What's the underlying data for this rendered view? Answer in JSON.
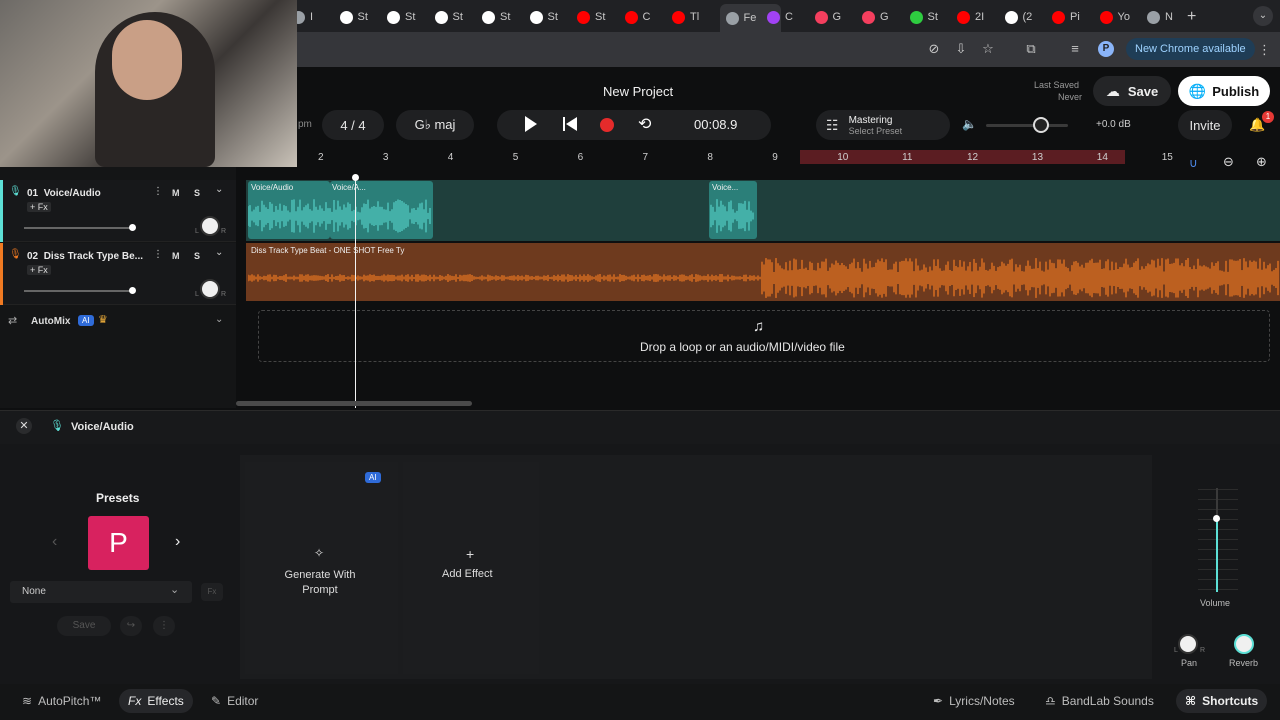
{
  "browser": {
    "tabs": [
      {
        "label": "I",
        "color": "#9aa0a6"
      },
      {
        "label": "St",
        "color": "#ffffff"
      },
      {
        "label": "St",
        "color": "#ffffff"
      },
      {
        "label": "St",
        "color": "#ffffff"
      },
      {
        "label": "St",
        "color": "#ffffff"
      },
      {
        "label": "St",
        "color": "#ffffff"
      },
      {
        "label": "St",
        "color": "#ff0000"
      },
      {
        "label": "C",
        "color": "#ff0000"
      },
      {
        "label": "Tl",
        "color": "#ff0000"
      },
      {
        "label": "Fe",
        "color": "#9aa0a6"
      },
      {
        "label": "C",
        "color": "#a142f4"
      },
      {
        "label": "G",
        "color": "#f43f5e"
      },
      {
        "label": "G",
        "color": "#f43f5e"
      },
      {
        "label": "St",
        "color": "#2ecc40"
      },
      {
        "label": "2I",
        "color": "#ff0000"
      },
      {
        "label": "(2",
        "color": "#ffffff"
      },
      {
        "label": "Pi",
        "color": "#ff0000"
      },
      {
        "label": "Yo",
        "color": "#ff0000"
      },
      {
        "label": "N",
        "color": "#9aa0a6"
      }
    ],
    "new_chrome": "New Chrome available",
    "profile_initial": "P"
  },
  "app": {
    "project_title": "New Project",
    "last_saved_label": "Last Saved",
    "last_saved_value": "Never",
    "save": "Save",
    "publish": "Publish",
    "tempo_suffix": "pm",
    "time_sig": "4 / 4",
    "key": "G♭ maj",
    "time": "00:08.9",
    "mastering": "Mastering",
    "select_preset": "Select Preset",
    "gain": "+0.0 dB",
    "invite": "Invite",
    "notif_count": "1",
    "accent": "#5de0d6",
    "orange": "#f07a22"
  },
  "ruler": {
    "marks": [
      "2",
      "3",
      "4",
      "5",
      "6",
      "7",
      "8",
      "9",
      "10",
      "11",
      "12",
      "13",
      "14",
      "15"
    ]
  },
  "tracks": [
    {
      "num": "01",
      "name": "Voice/Audio",
      "fx": "+ Fx",
      "mute": "M",
      "solo": "S",
      "color": "#5de0d6"
    },
    {
      "num": "02",
      "name": "Diss Track Type Be...",
      "fx": "+ Fx",
      "mute": "M",
      "solo": "S",
      "color": "#f07a22"
    }
  ],
  "automix": {
    "label": "AutoMix",
    "ai": "AI"
  },
  "clips": {
    "voice1": "Voice/Audio",
    "voice2": "Voice/A...",
    "voice3": "Voice...",
    "beat": "Diss Track Type Beat - ONE SHOT  Free Ty"
  },
  "dropzone": "Drop a loop or an audio/MIDI/video file",
  "panel": {
    "title": "Voice/Audio",
    "presets": "Presets",
    "preset_letter": "P",
    "preset_select": "None",
    "save": "Save",
    "ai_badge": "AI",
    "generate": "Generate With Prompt",
    "add_effect": "Add Effect",
    "volume": "Volume",
    "pan": "Pan",
    "reverb": "Reverb",
    "L": "L",
    "R": "R",
    "fx_small": "Fx"
  },
  "bottom": {
    "autopitch": "AutoPitch™",
    "effects": "Effects",
    "editor": "Editor",
    "lyrics": "Lyrics/Notes",
    "bandlab": "BandLab Sounds",
    "shortcuts": "Shortcuts"
  }
}
